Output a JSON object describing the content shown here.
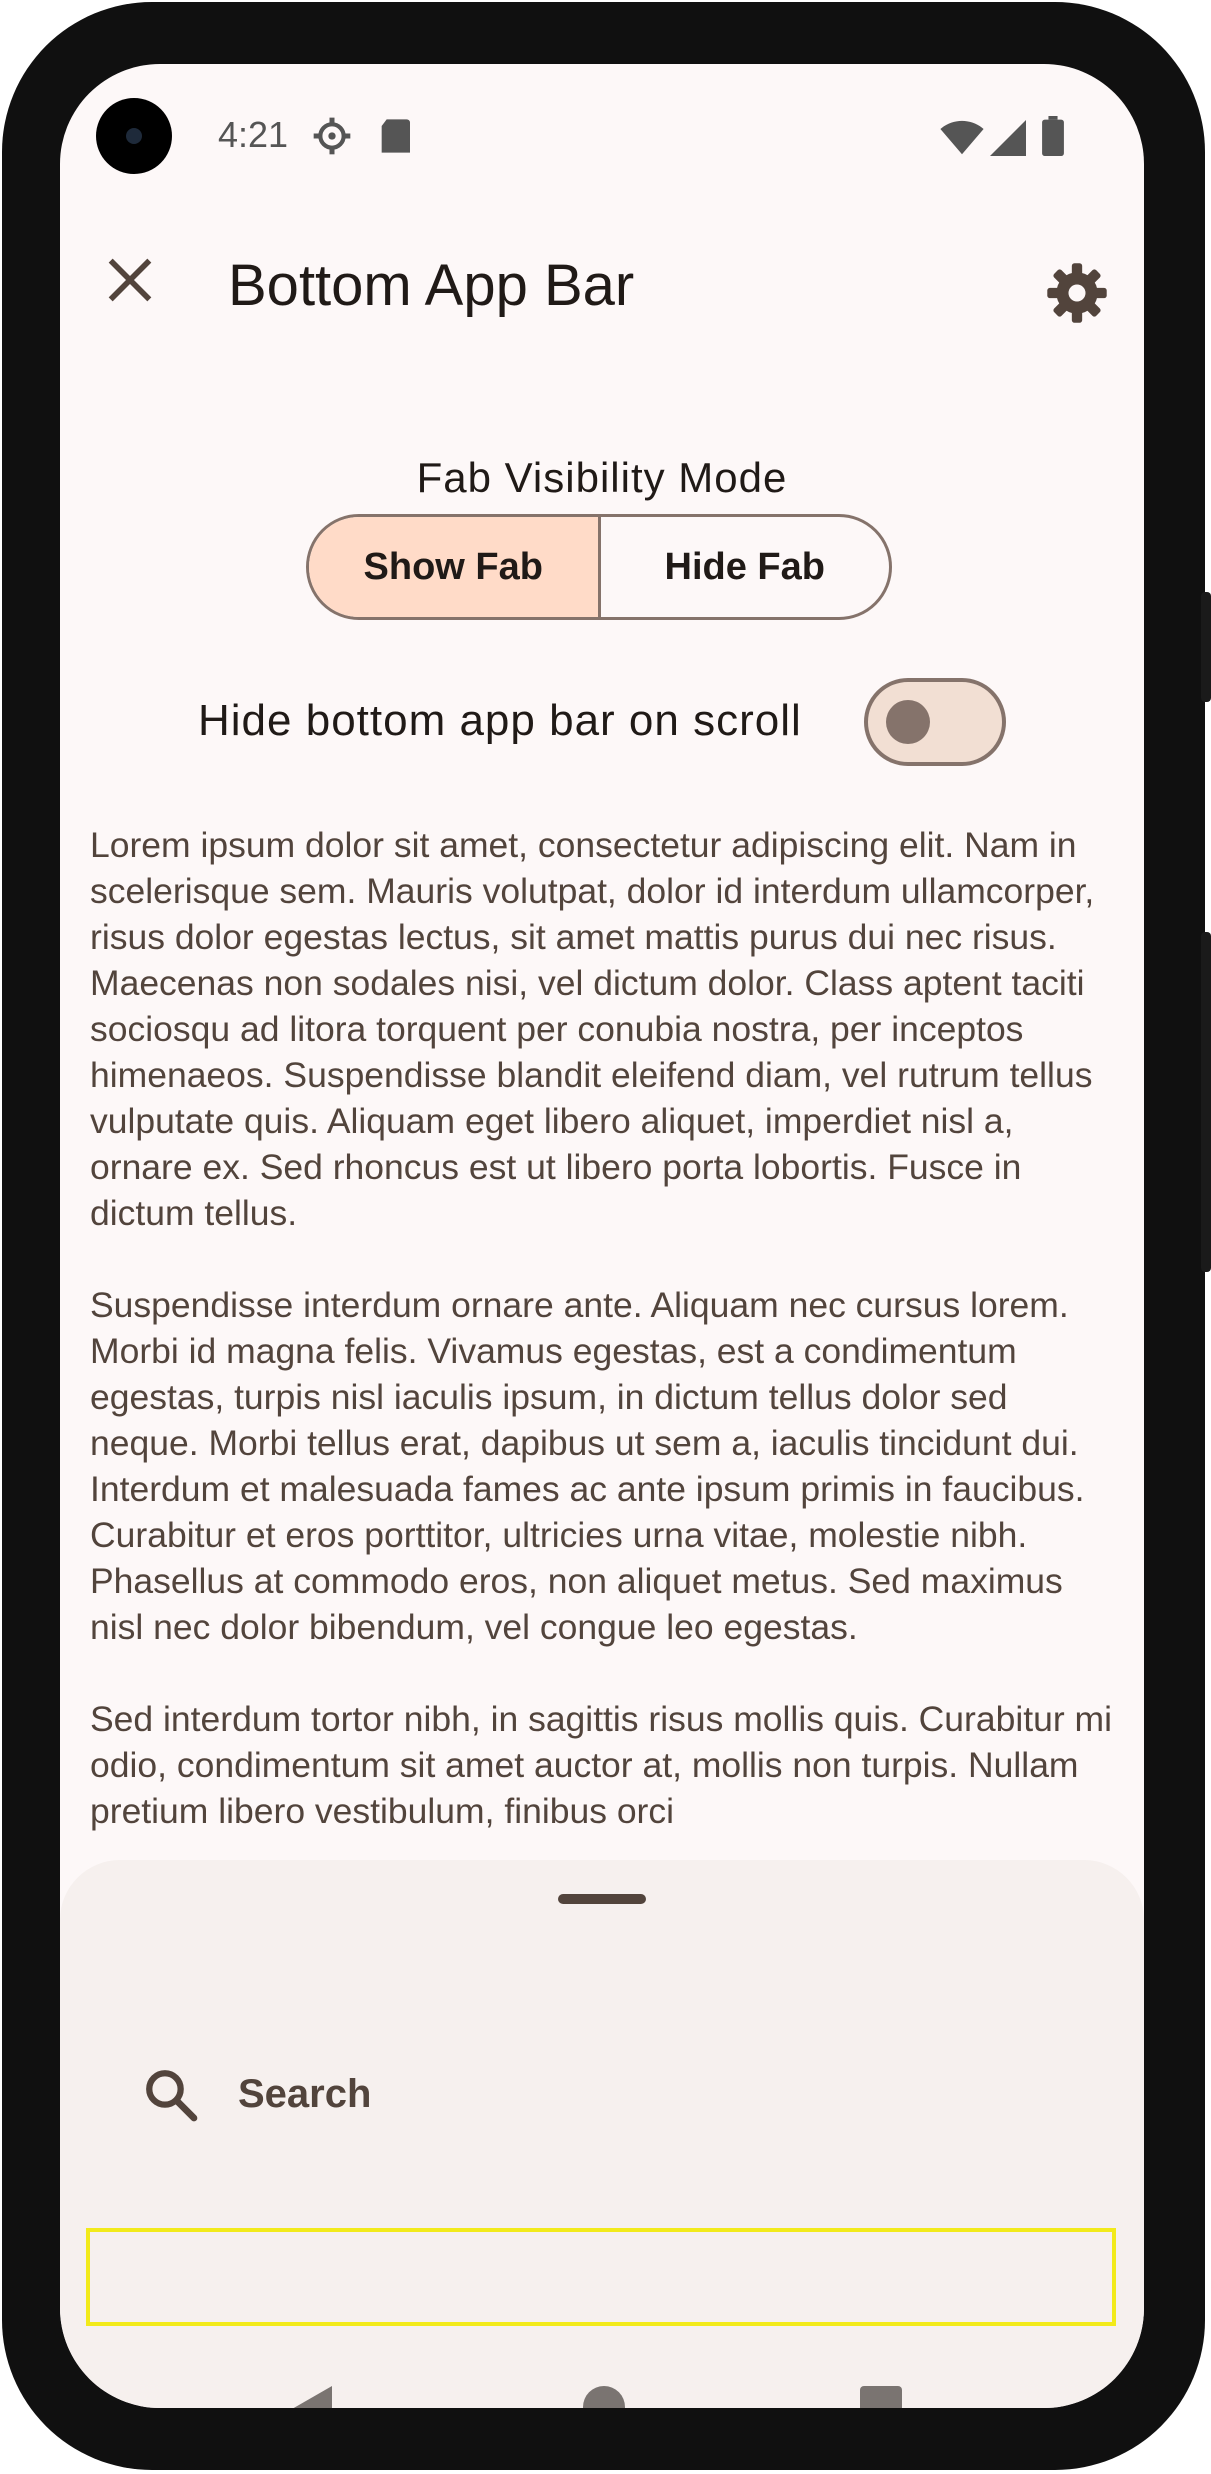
{
  "status_bar": {
    "time": "4:21",
    "icons": [
      "settings-gear-icon",
      "sd-card-icon",
      "wifi-icon",
      "cell-signal-icon",
      "battery-icon"
    ]
  },
  "top_bar": {
    "title": "Bottom App Bar",
    "close_icon": "close-icon",
    "settings_icon": "gear-icon"
  },
  "fab_visibility": {
    "label": "Fab Visibility Mode",
    "options": [
      "Show Fab",
      "Hide Fab"
    ],
    "selected": "Show Fab"
  },
  "scroll_toggle": {
    "label": "Hide bottom app bar on scroll",
    "checked": false
  },
  "body": {
    "paragraphs": [
      "Lorem ipsum dolor sit amet, consectetur adipiscing elit. Nam in scelerisque sem. Mauris volutpat, dolor id interdum ullamcorper, risus dolor egestas lectus, sit amet mattis purus dui nec risus. Maecenas non sodales nisi, vel dictum dolor. Class aptent taciti sociosqu ad litora torquent per conubia nostra, per inceptos himenaeos. Suspendisse blandit eleifend diam, vel rutrum tellus vulputate quis. Aliquam eget libero aliquet, imperdiet nisl a, ornare ex. Sed rhoncus est ut libero porta lobortis. Fusce in dictum tellus.",
      " Suspendisse interdum ornare ante. Aliquam nec cursus lorem. Morbi id magna felis. Vivamus egestas, est a condimentum egestas, turpis nisl iaculis ipsum, in dictum tellus dolor sed neque. Morbi tellus erat, dapibus ut sem a, iaculis tincidunt dui. Interdum et malesuada fames ac ante ipsum primis in faucibus. Curabitur et eros porttitor, ultricies urna vitae, molestie nibh. Phasellus at commodo eros, non aliquet metus. Sed maximus nisl nec dolor bibendum, vel congue leo egestas.",
      " Sed interdum tortor nibh, in sagittis risus mollis quis. Curabitur mi odio, condimentum sit amet auctor at, mollis non turpis. Nullam pretium libero vestibulum, finibus orci"
    ]
  },
  "bottom_sheet": {
    "search_label": "Search",
    "search_icon": "search-icon"
  },
  "nav_bar": {
    "buttons": [
      "back-icon",
      "home-icon",
      "recents-icon"
    ]
  },
  "colors": {
    "background": "#fdf8f8",
    "segment_selected": "#ffdbc8",
    "outline": "#85736b",
    "sheet": "#f6f0ee",
    "focus": "#f2ea1a"
  }
}
